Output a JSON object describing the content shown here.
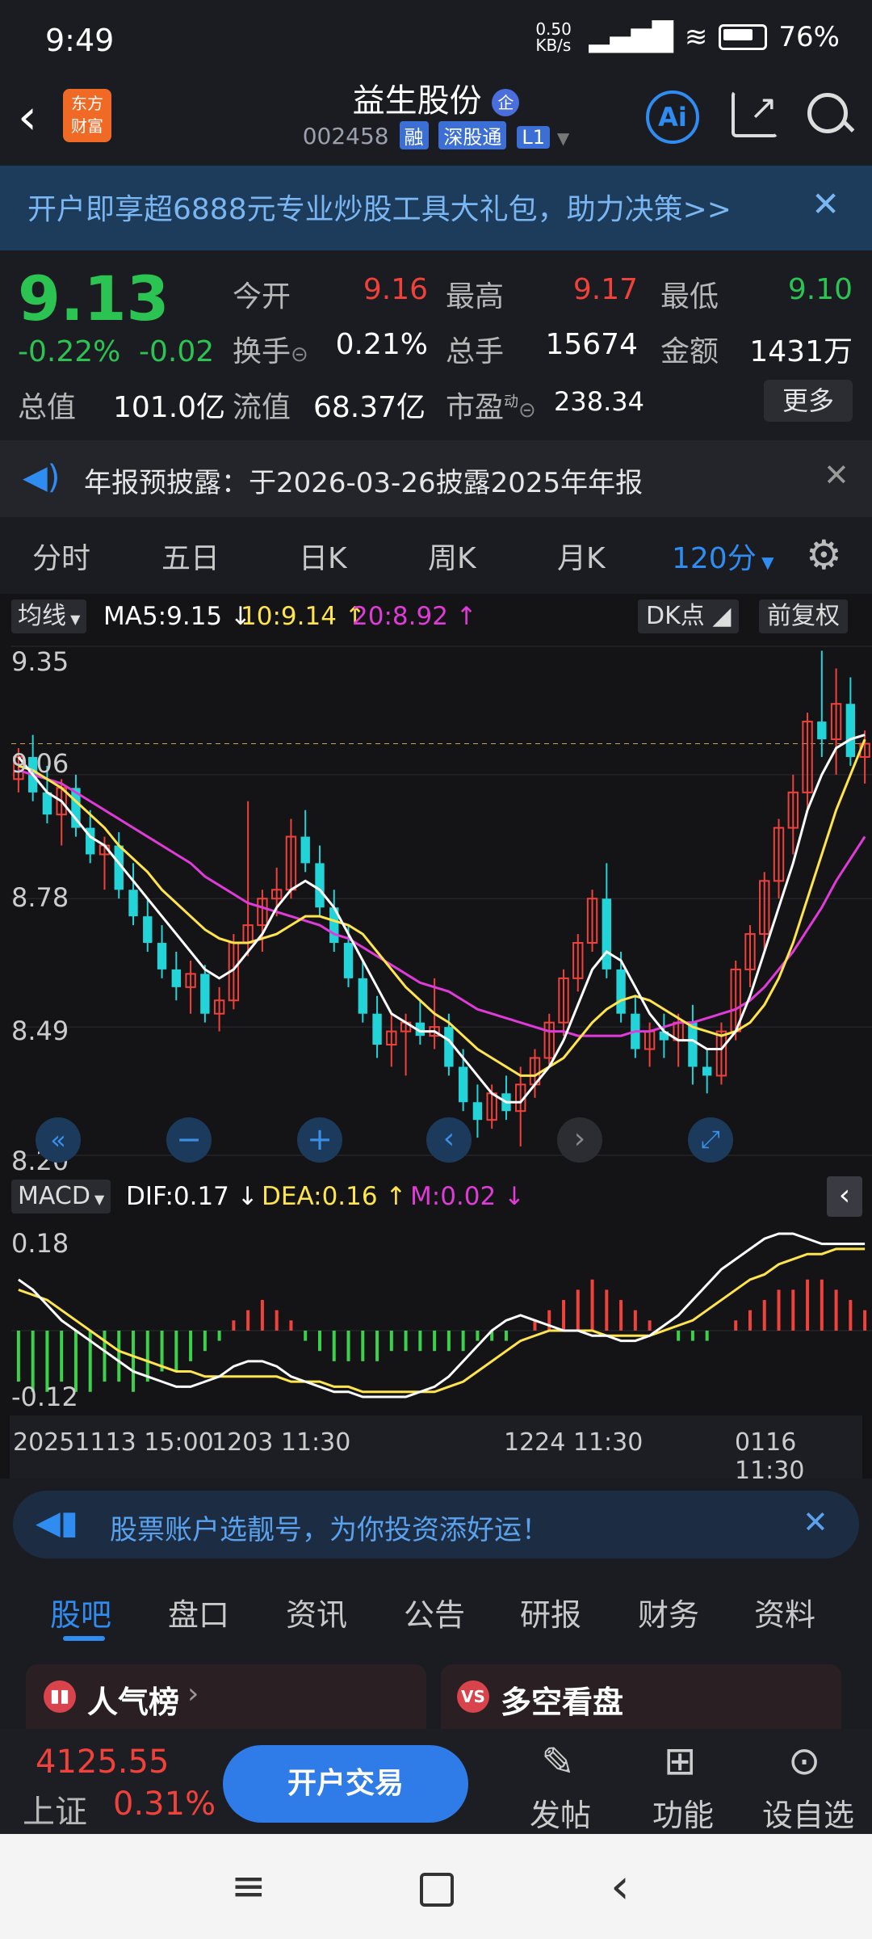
{
  "status": {
    "time": "9:49",
    "net_speed": "0.50 KB/s",
    "battery": "76%"
  },
  "header": {
    "logo_line1": "东方",
    "logo_line2": "财富",
    "title": "益生股份",
    "title_badge": "企",
    "code": "002458",
    "tags": [
      "融",
      "深股通",
      "L1"
    ],
    "ai_label": "Ai"
  },
  "banner": {
    "text": "开户即享超6888元专业炒股工具大礼包，助力决策>>"
  },
  "quote": {
    "price": "9.13",
    "pct": "-0.22%",
    "chg": "-0.02",
    "open_label": "今开",
    "open": "9.16",
    "high_label": "最高",
    "high": "9.17",
    "low_label": "最低",
    "low": "9.10",
    "turnover_label": "换手",
    "turnover": "0.21%",
    "volume_label": "总手",
    "volume": "15674",
    "amount_label": "金额",
    "amount": "1431万",
    "mktcap_label": "总值",
    "mktcap": "101.0亿",
    "float_label": "流值",
    "float": "68.37亿",
    "pe_label": "市盈",
    "pe_sup": "动",
    "pe": "238.34",
    "more": "更多"
  },
  "notice": {
    "text": "年报预披露：于2026-03-26披露2025年年报"
  },
  "period_tabs": [
    "分时",
    "五日",
    "日K",
    "周K",
    "月K",
    "120分"
  ],
  "ma_bar": {
    "selector": "均线",
    "ma5": "MA5:9.15",
    "ma10": "10:9.14",
    "ma20": "20:8.92",
    "dk": "DK点",
    "fq": "前复权"
  },
  "macd_bar": {
    "selector": "MACD",
    "dif": "DIF:0.17",
    "dea": "DEA:0.16",
    "m": "M:0.02"
  },
  "chart_data": {
    "type": "candlestick",
    "price_axis": {
      "labels": [
        "9.35",
        "9.06",
        "8.78",
        "8.49",
        "8.20"
      ],
      "ylim": [
        8.2,
        9.35
      ],
      "last_close": 9.13
    },
    "macd_axis": {
      "labels": [
        "0.18",
        "-0.12"
      ]
    },
    "x_labels": [
      "20251113 15:00",
      "1203 11:30",
      "1224 11:30",
      "0116 11:30"
    ],
    "candles": [
      [
        9.05,
        9.12,
        9.02,
        9.1
      ],
      [
        9.1,
        9.15,
        9.0,
        9.02
      ],
      [
        9.02,
        9.08,
        8.95,
        8.97
      ],
      [
        8.97,
        9.05,
        8.9,
        9.03
      ],
      [
        9.03,
        9.06,
        8.92,
        8.94
      ],
      [
        8.94,
        8.98,
        8.86,
        8.88
      ],
      [
        8.88,
        8.92,
        8.8,
        8.9
      ],
      [
        8.9,
        8.93,
        8.78,
        8.8
      ],
      [
        8.8,
        8.86,
        8.72,
        8.74
      ],
      [
        8.74,
        8.78,
        8.66,
        8.68
      ],
      [
        8.68,
        8.72,
        8.6,
        8.62
      ],
      [
        8.62,
        8.66,
        8.55,
        8.58
      ],
      [
        8.58,
        8.64,
        8.52,
        8.61
      ],
      [
        8.61,
        8.63,
        8.5,
        8.52
      ],
      [
        8.52,
        8.58,
        8.48,
        8.55
      ],
      [
        8.55,
        8.7,
        8.53,
        8.68
      ],
      [
        8.68,
        9.0,
        8.65,
        8.72
      ],
      [
        8.72,
        8.8,
        8.66,
        8.78
      ],
      [
        8.78,
        8.85,
        8.74,
        8.8
      ],
      [
        8.8,
        8.96,
        8.78,
        8.92
      ],
      [
        8.92,
        8.98,
        8.84,
        8.86
      ],
      [
        8.86,
        8.9,
        8.74,
        8.76
      ],
      [
        8.76,
        8.8,
        8.66,
        8.68
      ],
      [
        8.68,
        8.72,
        8.58,
        8.6
      ],
      [
        8.6,
        8.64,
        8.5,
        8.52
      ],
      [
        8.52,
        8.56,
        8.42,
        8.45
      ],
      [
        8.45,
        8.52,
        8.4,
        8.48
      ],
      [
        8.48,
        8.52,
        8.38,
        8.5
      ],
      [
        8.5,
        8.55,
        8.45,
        8.47
      ],
      [
        8.47,
        8.6,
        8.44,
        8.49
      ],
      [
        8.49,
        8.52,
        8.38,
        8.4
      ],
      [
        8.4,
        8.44,
        8.3,
        8.32
      ],
      [
        8.32,
        8.36,
        8.24,
        8.28
      ],
      [
        8.28,
        8.36,
        8.26,
        8.34
      ],
      [
        8.34,
        8.38,
        8.28,
        8.3
      ],
      [
        8.3,
        8.4,
        8.22,
        8.36
      ],
      [
        8.36,
        8.44,
        8.33,
        8.42
      ],
      [
        8.42,
        8.52,
        8.4,
        8.5
      ],
      [
        8.5,
        8.62,
        8.47,
        8.6
      ],
      [
        8.6,
        8.7,
        8.57,
        8.68
      ],
      [
        8.68,
        8.8,
        8.66,
        8.78
      ],
      [
        8.78,
        8.86,
        8.6,
        8.62
      ],
      [
        8.62,
        8.66,
        8.5,
        8.52
      ],
      [
        8.52,
        8.56,
        8.42,
        8.44
      ],
      [
        8.44,
        8.5,
        8.4,
        8.48
      ],
      [
        8.48,
        8.52,
        8.42,
        8.46
      ],
      [
        8.46,
        8.52,
        8.4,
        8.5
      ],
      [
        8.5,
        8.54,
        8.36,
        8.4
      ],
      [
        8.4,
        8.44,
        8.34,
        8.38
      ],
      [
        8.38,
        8.5,
        8.36,
        8.48
      ],
      [
        8.48,
        8.64,
        8.46,
        8.62
      ],
      [
        8.62,
        8.72,
        8.58,
        8.7
      ],
      [
        8.7,
        8.84,
        8.66,
        8.82
      ],
      [
        8.82,
        8.96,
        8.78,
        8.94
      ],
      [
        8.94,
        9.06,
        8.88,
        9.02
      ],
      [
        9.02,
        9.2,
        8.98,
        9.18
      ],
      [
        9.18,
        9.34,
        9.1,
        9.14
      ],
      [
        9.14,
        9.3,
        9.06,
        9.22
      ],
      [
        9.22,
        9.28,
        9.08,
        9.1
      ],
      [
        9.1,
        9.16,
        9.04,
        9.13
      ]
    ],
    "ma5": [
      9.1,
      9.06,
      9.02,
      9.0,
      8.96,
      8.92,
      8.9,
      8.86,
      8.82,
      8.78,
      8.74,
      8.7,
      8.66,
      8.62,
      8.6,
      8.62,
      8.66,
      8.7,
      8.76,
      8.8,
      8.82,
      8.8,
      8.76,
      8.7,
      8.64,
      8.58,
      8.52,
      8.5,
      8.48,
      8.48,
      8.46,
      8.42,
      8.38,
      8.34,
      8.32,
      8.32,
      8.36,
      8.4,
      8.46,
      8.54,
      8.62,
      8.66,
      8.64,
      8.58,
      8.52,
      8.48,
      8.46,
      8.46,
      8.44,
      8.44,
      8.48,
      8.56,
      8.66,
      8.76,
      8.86,
      8.98,
      9.06,
      9.12,
      9.14,
      9.15
    ],
    "ma10": [
      9.08,
      9.07,
      9.05,
      9.03,
      9.0,
      8.97,
      8.94,
      8.9,
      8.87,
      8.84,
      8.8,
      8.77,
      8.74,
      8.71,
      8.69,
      8.68,
      8.68,
      8.69,
      8.7,
      8.72,
      8.74,
      8.74,
      8.73,
      8.72,
      8.7,
      8.66,
      8.62,
      8.58,
      8.55,
      8.52,
      8.5,
      8.47,
      8.44,
      8.42,
      8.4,
      8.38,
      8.38,
      8.4,
      8.42,
      8.46,
      8.5,
      8.53,
      8.55,
      8.56,
      8.55,
      8.53,
      8.51,
      8.49,
      8.48,
      8.47,
      8.48,
      8.5,
      8.54,
      8.6,
      8.68,
      8.78,
      8.88,
      8.98,
      9.06,
      9.14
    ],
    "ma20": [
      9.07,
      9.06,
      9.05,
      9.04,
      9.02,
      9.0,
      8.98,
      8.96,
      8.94,
      8.92,
      8.9,
      8.88,
      8.86,
      8.83,
      8.81,
      8.79,
      8.77,
      8.76,
      8.75,
      8.74,
      8.73,
      8.72,
      8.7,
      8.69,
      8.67,
      8.65,
      8.63,
      8.61,
      8.59,
      8.58,
      8.57,
      8.55,
      8.53,
      8.52,
      8.51,
      8.5,
      8.49,
      8.48,
      8.48,
      8.47,
      8.47,
      8.47,
      8.47,
      8.48,
      8.48,
      8.49,
      8.5,
      8.5,
      8.51,
      8.52,
      8.53,
      8.55,
      8.58,
      8.62,
      8.66,
      8.71,
      8.76,
      8.82,
      8.87,
      8.92
    ],
    "macd_hist": [
      -0.05,
      -0.06,
      -0.06,
      -0.05,
      -0.06,
      -0.06,
      -0.05,
      -0.05,
      -0.06,
      -0.05,
      -0.04,
      -0.04,
      -0.03,
      -0.02,
      -0.01,
      0.01,
      0.02,
      0.03,
      0.02,
      0.01,
      -0.01,
      -0.02,
      -0.03,
      -0.03,
      -0.03,
      -0.03,
      -0.02,
      -0.02,
      -0.02,
      -0.02,
      -0.02,
      -0.02,
      -0.01,
      -0.01,
      -0.01,
      0.0,
      0.01,
      0.02,
      0.03,
      0.04,
      0.05,
      0.04,
      0.03,
      0.02,
      0.01,
      0.0,
      -0.01,
      -0.01,
      -0.01,
      0.0,
      0.01,
      0.02,
      0.03,
      0.04,
      0.04,
      0.05,
      0.05,
      0.04,
      0.03,
      0.02
    ],
    "dif": [
      0.1,
      0.08,
      0.05,
      0.02,
      0.0,
      -0.02,
      -0.04,
      -0.06,
      -0.08,
      -0.09,
      -0.1,
      -0.11,
      -0.11,
      -0.1,
      -0.09,
      -0.07,
      -0.06,
      -0.06,
      -0.07,
      -0.09,
      -0.1,
      -0.11,
      -0.12,
      -0.12,
      -0.13,
      -0.13,
      -0.13,
      -0.13,
      -0.12,
      -0.11,
      -0.09,
      -0.06,
      -0.03,
      0.0,
      0.02,
      0.03,
      0.02,
      0.01,
      0.0,
      0.0,
      -0.01,
      -0.01,
      -0.02,
      -0.02,
      -0.01,
      0.01,
      0.03,
      0.06,
      0.09,
      0.12,
      0.14,
      0.16,
      0.18,
      0.19,
      0.19,
      0.18,
      0.17,
      0.17,
      0.17,
      0.17
    ],
    "dea": [
      0.08,
      0.07,
      0.06,
      0.04,
      0.02,
      0.0,
      -0.02,
      -0.04,
      -0.05,
      -0.06,
      -0.07,
      -0.08,
      -0.08,
      -0.09,
      -0.09,
      -0.09,
      -0.09,
      -0.09,
      -0.09,
      -0.1,
      -0.1,
      -0.1,
      -0.11,
      -0.11,
      -0.12,
      -0.12,
      -0.12,
      -0.12,
      -0.12,
      -0.12,
      -0.11,
      -0.1,
      -0.08,
      -0.06,
      -0.04,
      -0.02,
      -0.01,
      0.0,
      0.0,
      0.0,
      0.0,
      -0.01,
      -0.01,
      -0.01,
      -0.01,
      0.0,
      0.01,
      0.02,
      0.04,
      0.06,
      0.08,
      0.1,
      0.11,
      0.13,
      0.14,
      0.15,
      0.15,
      0.16,
      0.16,
      0.16
    ]
  },
  "bottom_banner": {
    "text": "股票账户选靓号，为你投资添好运！"
  },
  "content_tabs": [
    "股吧",
    "盘口",
    "资讯",
    "公告",
    "研报",
    "财务",
    "资料"
  ],
  "cards": [
    {
      "label": "人气榜"
    },
    {
      "label": "多空看盘"
    }
  ],
  "bottombar": {
    "index_value": "4125.55",
    "index_name": "上证",
    "index_pct": "0.31%",
    "trade": "开户交易",
    "post": "发帖",
    "func": "功能",
    "watch": "设自选"
  }
}
